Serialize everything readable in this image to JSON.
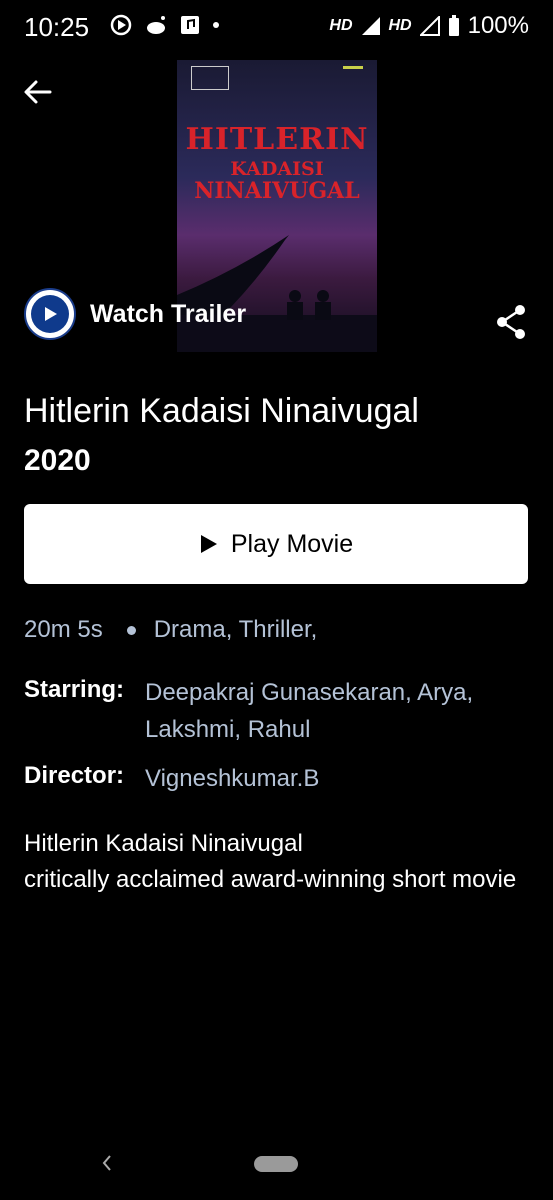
{
  "status_bar": {
    "time": "10:25",
    "hd1": "HD",
    "hd2": "HD",
    "battery": "100%"
  },
  "trailer": {
    "label": "Watch Trailer"
  },
  "poster": {
    "title_line1": "HITLERIN",
    "title_line2": "KADAISI",
    "title_line3": "NINAIVUGAL"
  },
  "movie": {
    "title": "Hitlerin Kadaisi Ninaivugal",
    "year": "2020",
    "play_label": "Play Movie",
    "duration": "20m 5s",
    "genres": "Drama, Thriller,",
    "starring_label": "Starring:",
    "starring_value": "Deepakraj Gunasekaran, Arya, Lakshmi, Rahul",
    "director_label": "Director:",
    "director_value": "Vigneshkumar.B",
    "description_line1": "Hitlerin Kadaisi Ninaivugal",
    "description_line2": "critically acclaimed award-winning short movie"
  },
  "colors": {
    "accent_blue": "#0f3a8c",
    "meta_text": "#b4c2d6",
    "poster_red": "#d9232a"
  },
  "icons": [
    "back-arrow-icon",
    "play-icon",
    "share-icon",
    "nav-back-icon",
    "nav-home-pill"
  ]
}
